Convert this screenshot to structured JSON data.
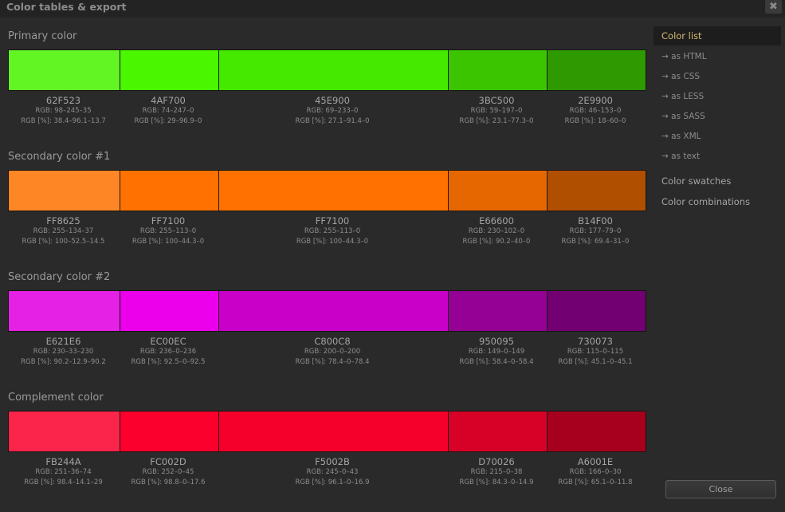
{
  "window": {
    "title": "Color tables & export",
    "close_glyph": "✖"
  },
  "sections": [
    {
      "title": "Primary color",
      "swatches": [
        {
          "color": "#62F523",
          "hex": "62F523",
          "rgb": "RGB: 98–245–35",
          "pct": "RGB [%]: 38.4–96.1–13.7"
        },
        {
          "color": "#4AF700",
          "hex": "4AF700",
          "rgb": "RGB: 74–247–0",
          "pct": "RGB [%]: 29–96.9–0"
        },
        {
          "color": "#45E900",
          "hex": "45E900",
          "rgb": "RGB: 69–233–0",
          "pct": "RGB [%]: 27.1–91.4–0"
        },
        {
          "color": "#3BC500",
          "hex": "3BC500",
          "rgb": "RGB: 59–197–0",
          "pct": "RGB [%]: 23.1–77.3–0"
        },
        {
          "color": "#2E9900",
          "hex": "2E9900",
          "rgb": "RGB: 46–153–0",
          "pct": "RGB [%]: 18–60–0"
        }
      ]
    },
    {
      "title": "Secondary color #1",
      "swatches": [
        {
          "color": "#FF8625",
          "hex": "FF8625",
          "rgb": "RGB: 255–134–37",
          "pct": "RGB [%]: 100–52.5–14.5"
        },
        {
          "color": "#FF7100",
          "hex": "FF7100",
          "rgb": "RGB: 255–113–0",
          "pct": "RGB [%]: 100–44.3–0"
        },
        {
          "color": "#FF7100",
          "hex": "FF7100",
          "rgb": "RGB: 255–113–0",
          "pct": "RGB [%]: 100–44.3–0"
        },
        {
          "color": "#E66600",
          "hex": "E66600",
          "rgb": "RGB: 230–102–0",
          "pct": "RGB [%]: 90.2–40–0"
        },
        {
          "color": "#B14F00",
          "hex": "B14F00",
          "rgb": "RGB: 177–79–0",
          "pct": "RGB [%]: 69.4–31–0"
        }
      ]
    },
    {
      "title": "Secondary color #2",
      "swatches": [
        {
          "color": "#E621E6",
          "hex": "E621E6",
          "rgb": "RGB: 230–33–230",
          "pct": "RGB [%]: 90.2–12.9–90.2"
        },
        {
          "color": "#EC00EC",
          "hex": "EC00EC",
          "rgb": "RGB: 236–0–236",
          "pct": "RGB [%]: 92.5–0–92.5"
        },
        {
          "color": "#C800C8",
          "hex": "C800C8",
          "rgb": "RGB: 200–0–200",
          "pct": "RGB [%]: 78.4–0–78.4"
        },
        {
          "color": "#950095",
          "hex": "950095",
          "rgb": "RGB: 149–0–149",
          "pct": "RGB [%]: 58.4–0–58.4"
        },
        {
          "color": "#730073",
          "hex": "730073",
          "rgb": "RGB: 115–0–115",
          "pct": "RGB [%]: 45.1–0–45.1"
        }
      ]
    },
    {
      "title": "Complement color",
      "swatches": [
        {
          "color": "#FB244A",
          "hex": "FB244A",
          "rgb": "RGB: 251–36–74",
          "pct": "RGB [%]: 98.4–14.1–29"
        },
        {
          "color": "#FC002D",
          "hex": "FC002D",
          "rgb": "RGB: 252–0–45",
          "pct": "RGB [%]: 98.8–0–17.6"
        },
        {
          "color": "#F5002B",
          "hex": "F5002B",
          "rgb": "RGB: 245–0–43",
          "pct": "RGB [%]: 96.1–0–16.9"
        },
        {
          "color": "#D70026",
          "hex": "D70026",
          "rgb": "RGB: 215–0–38",
          "pct": "RGB [%]: 84.3–0–14.9"
        },
        {
          "color": "#A6001E",
          "hex": "A6001E",
          "rgb": "RGB: 166–0–30",
          "pct": "RGB [%]: 65.1–0–11.8"
        }
      ]
    }
  ],
  "sidebar": {
    "color_list": "Color list",
    "exports": [
      "→ as HTML",
      "→ as CSS",
      "→ as LESS",
      "→ as SASS",
      "→ as XML",
      "→ as text"
    ],
    "color_swatches": "Color swatches",
    "color_combinations": "Color combinations"
  },
  "footer": {
    "close_label": "Close"
  },
  "theme": {
    "accent": "#d1b96f",
    "background": "#2a2a2a"
  }
}
